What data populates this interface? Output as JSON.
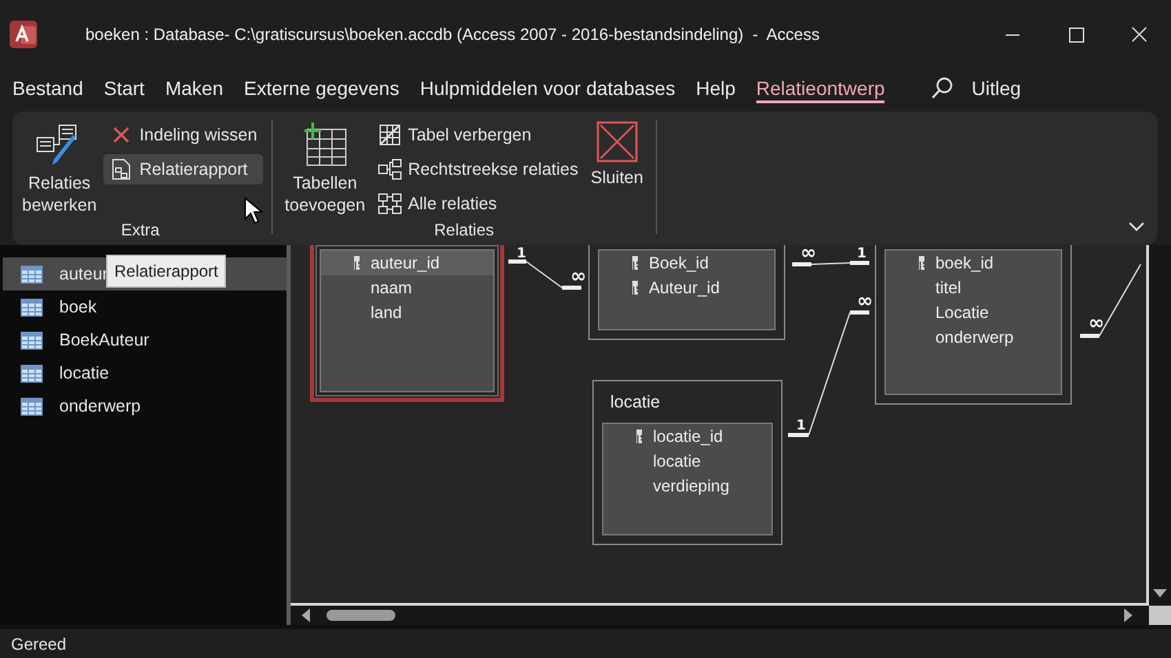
{
  "window": {
    "title": "boeken : Database- C:\\gratiscursus\\boeken.accdb (Access 2007 - 2016-bestandsindeling)  -  Access"
  },
  "menu_tabs": [
    {
      "label": "Bestand",
      "selected": false
    },
    {
      "label": "Start",
      "selected": false
    },
    {
      "label": "Maken",
      "selected": false
    },
    {
      "label": "Externe gegevens",
      "selected": false
    },
    {
      "label": "Hulpmiddelen voor databases",
      "selected": false
    },
    {
      "label": "Help",
      "selected": false
    },
    {
      "label": "Relatieontwerp",
      "selected": true
    }
  ],
  "tell_me": "Uitleg",
  "ribbon": {
    "groups": [
      {
        "label": "Extra",
        "buttons": [
          {
            "kind": "large",
            "label": "Relaties bewerken"
          },
          {
            "kind": "small",
            "label": "Indeling wissen",
            "hovered": false
          },
          {
            "kind": "small",
            "label": "Relatierapport",
            "hovered": true
          }
        ]
      },
      {
        "label": "Relaties",
        "buttons": [
          {
            "kind": "large",
            "label": "Tabellen toevoegen"
          },
          {
            "kind": "small",
            "label": "Tabel verbergen",
            "hovered": false
          },
          {
            "kind": "small",
            "label": "Rechtstreekse relaties",
            "hovered": false
          },
          {
            "kind": "small",
            "label": "Alle relaties",
            "hovered": false
          },
          {
            "kind": "large",
            "label": "Sluiten"
          }
        ]
      }
    ]
  },
  "tooltip": "Relatierapport",
  "navigation": {
    "items": [
      {
        "label": "auteur",
        "selected": true
      },
      {
        "label": "boek",
        "selected": false
      },
      {
        "label": "BoekAuteur",
        "selected": false
      },
      {
        "label": "locatie",
        "selected": false
      },
      {
        "label": "onderwerp",
        "selected": false
      }
    ]
  },
  "diagram": {
    "tables": [
      {
        "selected": true,
        "fields": [
          {
            "name": "auteur_id",
            "key": true,
            "selected": true
          },
          {
            "name": "naam",
            "key": false,
            "selected": false
          },
          {
            "name": "land",
            "key": false,
            "selected": false
          }
        ]
      },
      {
        "selected": false,
        "fields": [
          {
            "name": "Boek_id",
            "key": true,
            "selected": false
          },
          {
            "name": "Auteur_id",
            "key": true,
            "selected": false
          }
        ]
      },
      {
        "selected": false,
        "fields": [
          {
            "name": "boek_id",
            "key": true,
            "selected": false
          },
          {
            "name": "titel",
            "key": false,
            "selected": false
          },
          {
            "name": "Locatie",
            "key": false,
            "selected": false
          },
          {
            "name": "onderwerp",
            "key": false,
            "selected": false
          }
        ]
      },
      {
        "title": "locatie",
        "selected": false,
        "fields": [
          {
            "name": "locatie_id",
            "key": true,
            "selected": false
          },
          {
            "name": "locatie",
            "key": false,
            "selected": false
          },
          {
            "name": "verdieping",
            "key": false,
            "selected": false
          }
        ]
      }
    ],
    "relations": [
      {
        "one": "1",
        "many": "∞"
      },
      {
        "one": "1",
        "many": "∞"
      },
      {
        "one": "1",
        "many": "∞"
      },
      {
        "many": "∞"
      }
    ]
  },
  "status_bar": "Gereed"
}
